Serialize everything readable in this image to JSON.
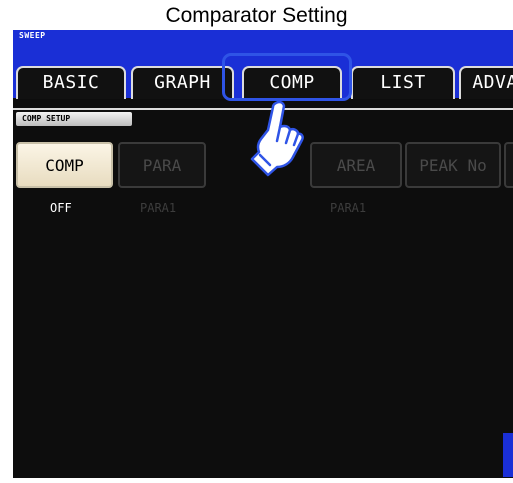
{
  "title": "Comparator Setting",
  "mode": "SWEEP",
  "tabs": [
    {
      "label": "BASIC"
    },
    {
      "label": "GRAPH"
    },
    {
      "label": "COMP"
    },
    {
      "label": "LIST"
    },
    {
      "label": "ADVA"
    }
  ],
  "section": {
    "label": "COMP SETUP"
  },
  "buttons": [
    {
      "label": "COMP",
      "value": "OFF",
      "state": "enabled"
    },
    {
      "label": "PARA",
      "value": "PARA1",
      "state": "disabled"
    },
    {
      "label": "AREA",
      "value": "PARA1",
      "state": "disabled"
    },
    {
      "label": "PEAK No",
      "value": "",
      "state": "disabled"
    }
  ],
  "colors": {
    "accent": "#1a2fd6",
    "highlight": "#2f54e6",
    "screen": "#0d0d0d"
  },
  "icons": {
    "pointer": "pointing-hand-icon"
  }
}
